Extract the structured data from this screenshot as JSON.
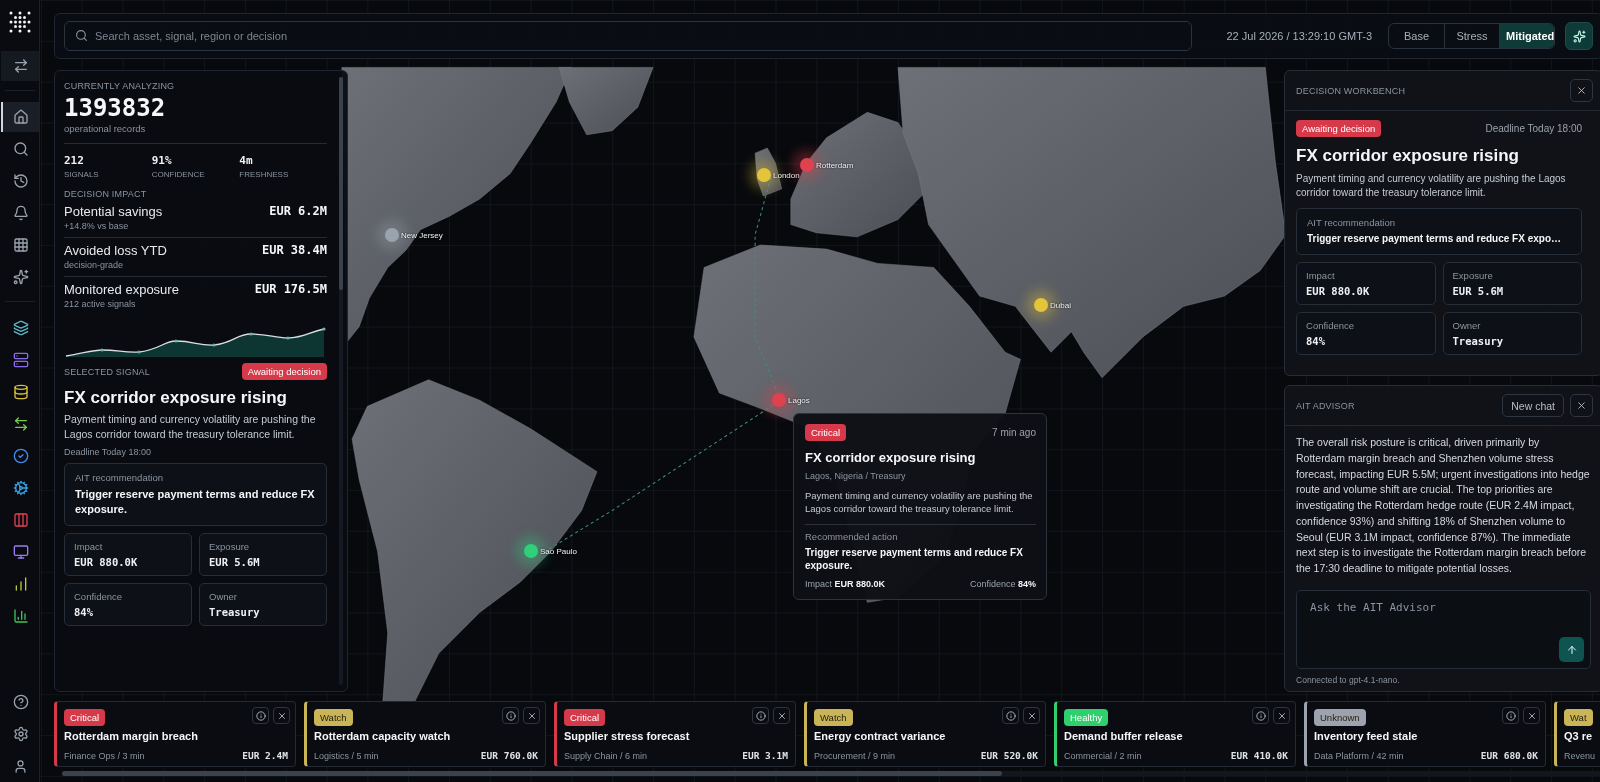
{
  "sidebar": {
    "nav": [
      {
        "selected": true
      },
      {
        "selected": false
      },
      {
        "selected": false
      },
      {
        "selected": false
      },
      {
        "selected": false
      },
      {
        "selected": false
      }
    ]
  },
  "topbar": {
    "search": {
      "placeholder": "Search asset, signal, region or decision"
    },
    "datetime": "22 Jul 2026 / 13:29:10 GMT-3",
    "scenarios": [
      {
        "label": "Base",
        "selected": false
      },
      {
        "label": "Stress",
        "selected": false
      },
      {
        "label": "Mitigated",
        "selected": true
      }
    ]
  },
  "analysis": {
    "eyebrow": "CURRENTLY ANALYZING",
    "count": "1393832",
    "count_label": "operational records",
    "stats": [
      {
        "value": "212",
        "label": "SIGNALS"
      },
      {
        "value": "91%",
        "label": "CONFIDENCE"
      },
      {
        "value": "4m",
        "label": "FRESHNESS"
      }
    ],
    "impact_heading": "DECISION IMPACT",
    "impacts": [
      {
        "title": "Potential savings",
        "note": "+14.8% vs base",
        "value": "EUR 6.2M"
      },
      {
        "title": "Avoided loss YTD",
        "note": "decision-grade",
        "value": "EUR 38.4M"
      },
      {
        "title": "Monitored exposure",
        "note": "212 active signals",
        "value": "EUR 176.5M"
      }
    ],
    "signal_heading": "SELECTED SIGNAL",
    "signal_status": "Awaiting decision",
    "signal_title": "FX corridor exposure rising",
    "signal_text": "Payment timing and currency volatility are pushing the Lagos corridor toward the treasury tolerance limit.",
    "deadline": "Deadline Today 18:00",
    "recommendation": {
      "label": "AIT recommendation",
      "text": "Trigger reserve payment terms and reduce FX exposure."
    },
    "metrics": [
      {
        "label": "Impact",
        "value": "EUR 880.0K"
      },
      {
        "label": "Exposure",
        "value": "EUR 5.6M"
      },
      {
        "label": "Confidence",
        "value": "84%"
      },
      {
        "label": "Owner",
        "value": "Treasury"
      }
    ]
  },
  "map": {
    "markers": [
      {
        "label": "London",
        "color": "#e5c33a"
      },
      {
        "label": "Rotterdam",
        "color": "#e0414f"
      },
      {
        "label": "New Jersey",
        "color": "#9aa3ad"
      },
      {
        "label": "Dubai",
        "color": "#e5c33a"
      },
      {
        "label": "Lagos",
        "color": "#e0414f"
      },
      {
        "label": "Sao Paulo",
        "color": "#2fd07a"
      }
    ],
    "popup": {
      "status": "Critical",
      "time": "7 min ago",
      "title": "FX corridor exposure rising",
      "location": "Lagos, Nigeria / Treasury",
      "text": "Payment timing and currency volatility are pushing the Lagos corridor toward the treasury tolerance limit.",
      "action_label": "Recommended action",
      "action": "Trigger reserve payment terms and reduce FX exposure.",
      "impact": "Impact **EUR 880.0K**",
      "confidence": "Confidence **84%**"
    }
  },
  "workbench": {
    "title": "DECISION WORKBENCH",
    "status": "Awaiting decision",
    "deadline": "Deadline Today 18:00",
    "heading": "FX corridor exposure rising",
    "text": "Payment timing and currency volatility are pushing the Lagos corridor toward the treasury tolerance limit.",
    "recommendation": {
      "label": "AIT recommendation",
      "text": "Trigger reserve payment terms and reduce FX expo…"
    },
    "metrics": [
      {
        "label": "Impact",
        "value": "EUR 880.0K"
      },
      {
        "label": "Exposure",
        "value": "EUR 5.6M"
      },
      {
        "label": "Confidence",
        "value": "84%"
      },
      {
        "label": "Owner",
        "value": "Treasury"
      }
    ]
  },
  "advisor": {
    "title": "AIT ADVISOR",
    "new_chat": "New chat",
    "message": "The overall risk posture is critical, driven primarily by Rotterdam margin breach and Shenzhen volume stress forecast, impacting EUR 5.5M; urgent investigations into hedge route and volume shift are crucial. The top priorities are investigating the Rotterdam hedge route (EUR 2.4M impact, confidence 93%) and shifting 18% of Shenzhen volume to Seoul (EUR 3.1M impact, confidence 87%). The immediate next step is to investigate the Rotterdam margin breach before the 17:30 deadline to mitigate potential losses.",
    "placeholder": "Ask the AIT Advisor",
    "status": "Connected to gpt-4.1-nano."
  },
  "alerts": [
    {
      "status": "Critical",
      "color": "#d63a4a",
      "title": "Rotterdam margin breach",
      "meta": "Finance Ops / 3 min",
      "value": "EUR 2.4M"
    },
    {
      "status": "Watch",
      "color": "#c9b458",
      "title": "Rotterdam capacity watch",
      "meta": "Logistics / 5 min",
      "value": "EUR 760.0K"
    },
    {
      "status": "Critical",
      "color": "#d63a4a",
      "title": "Supplier stress forecast",
      "meta": "Supply Chain / 6 min",
      "value": "EUR 3.1M"
    },
    {
      "status": "Watch",
      "color": "#c9b458",
      "title": "Energy contract variance",
      "meta": "Procurement / 9 min",
      "value": "EUR 520.0K"
    },
    {
      "status": "Healthy",
      "color": "#2fcf6e",
      "title": "Demand buffer release",
      "meta": "Commercial / 2 min",
      "value": "EUR 410.0K"
    },
    {
      "status": "Unknown",
      "color": "#9ca3af",
      "title": "Inventory feed stale",
      "meta": "Data Platform / 42 min",
      "value": "EUR 680.0K"
    },
    {
      "status": "Wat",
      "color": "#c9b458",
      "title": "Q3 re",
      "meta": "Revenu"
    }
  ]
}
